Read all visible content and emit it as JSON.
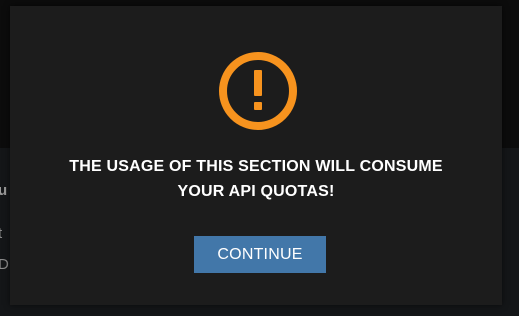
{
  "modal": {
    "message_line1": "THE USAGE OF THIS SECTION WILL CONSUME",
    "message_line2": "YOUR API QUOTAS!",
    "continue_label": "CONTINUE",
    "icon": "warning-exclamation-icon",
    "icon_color": "#f7931e",
    "button_color": "#4277a9"
  },
  "background": {
    "partial_text_1": "u",
    "partial_text_2": "t",
    "partial_text_3": "D"
  }
}
